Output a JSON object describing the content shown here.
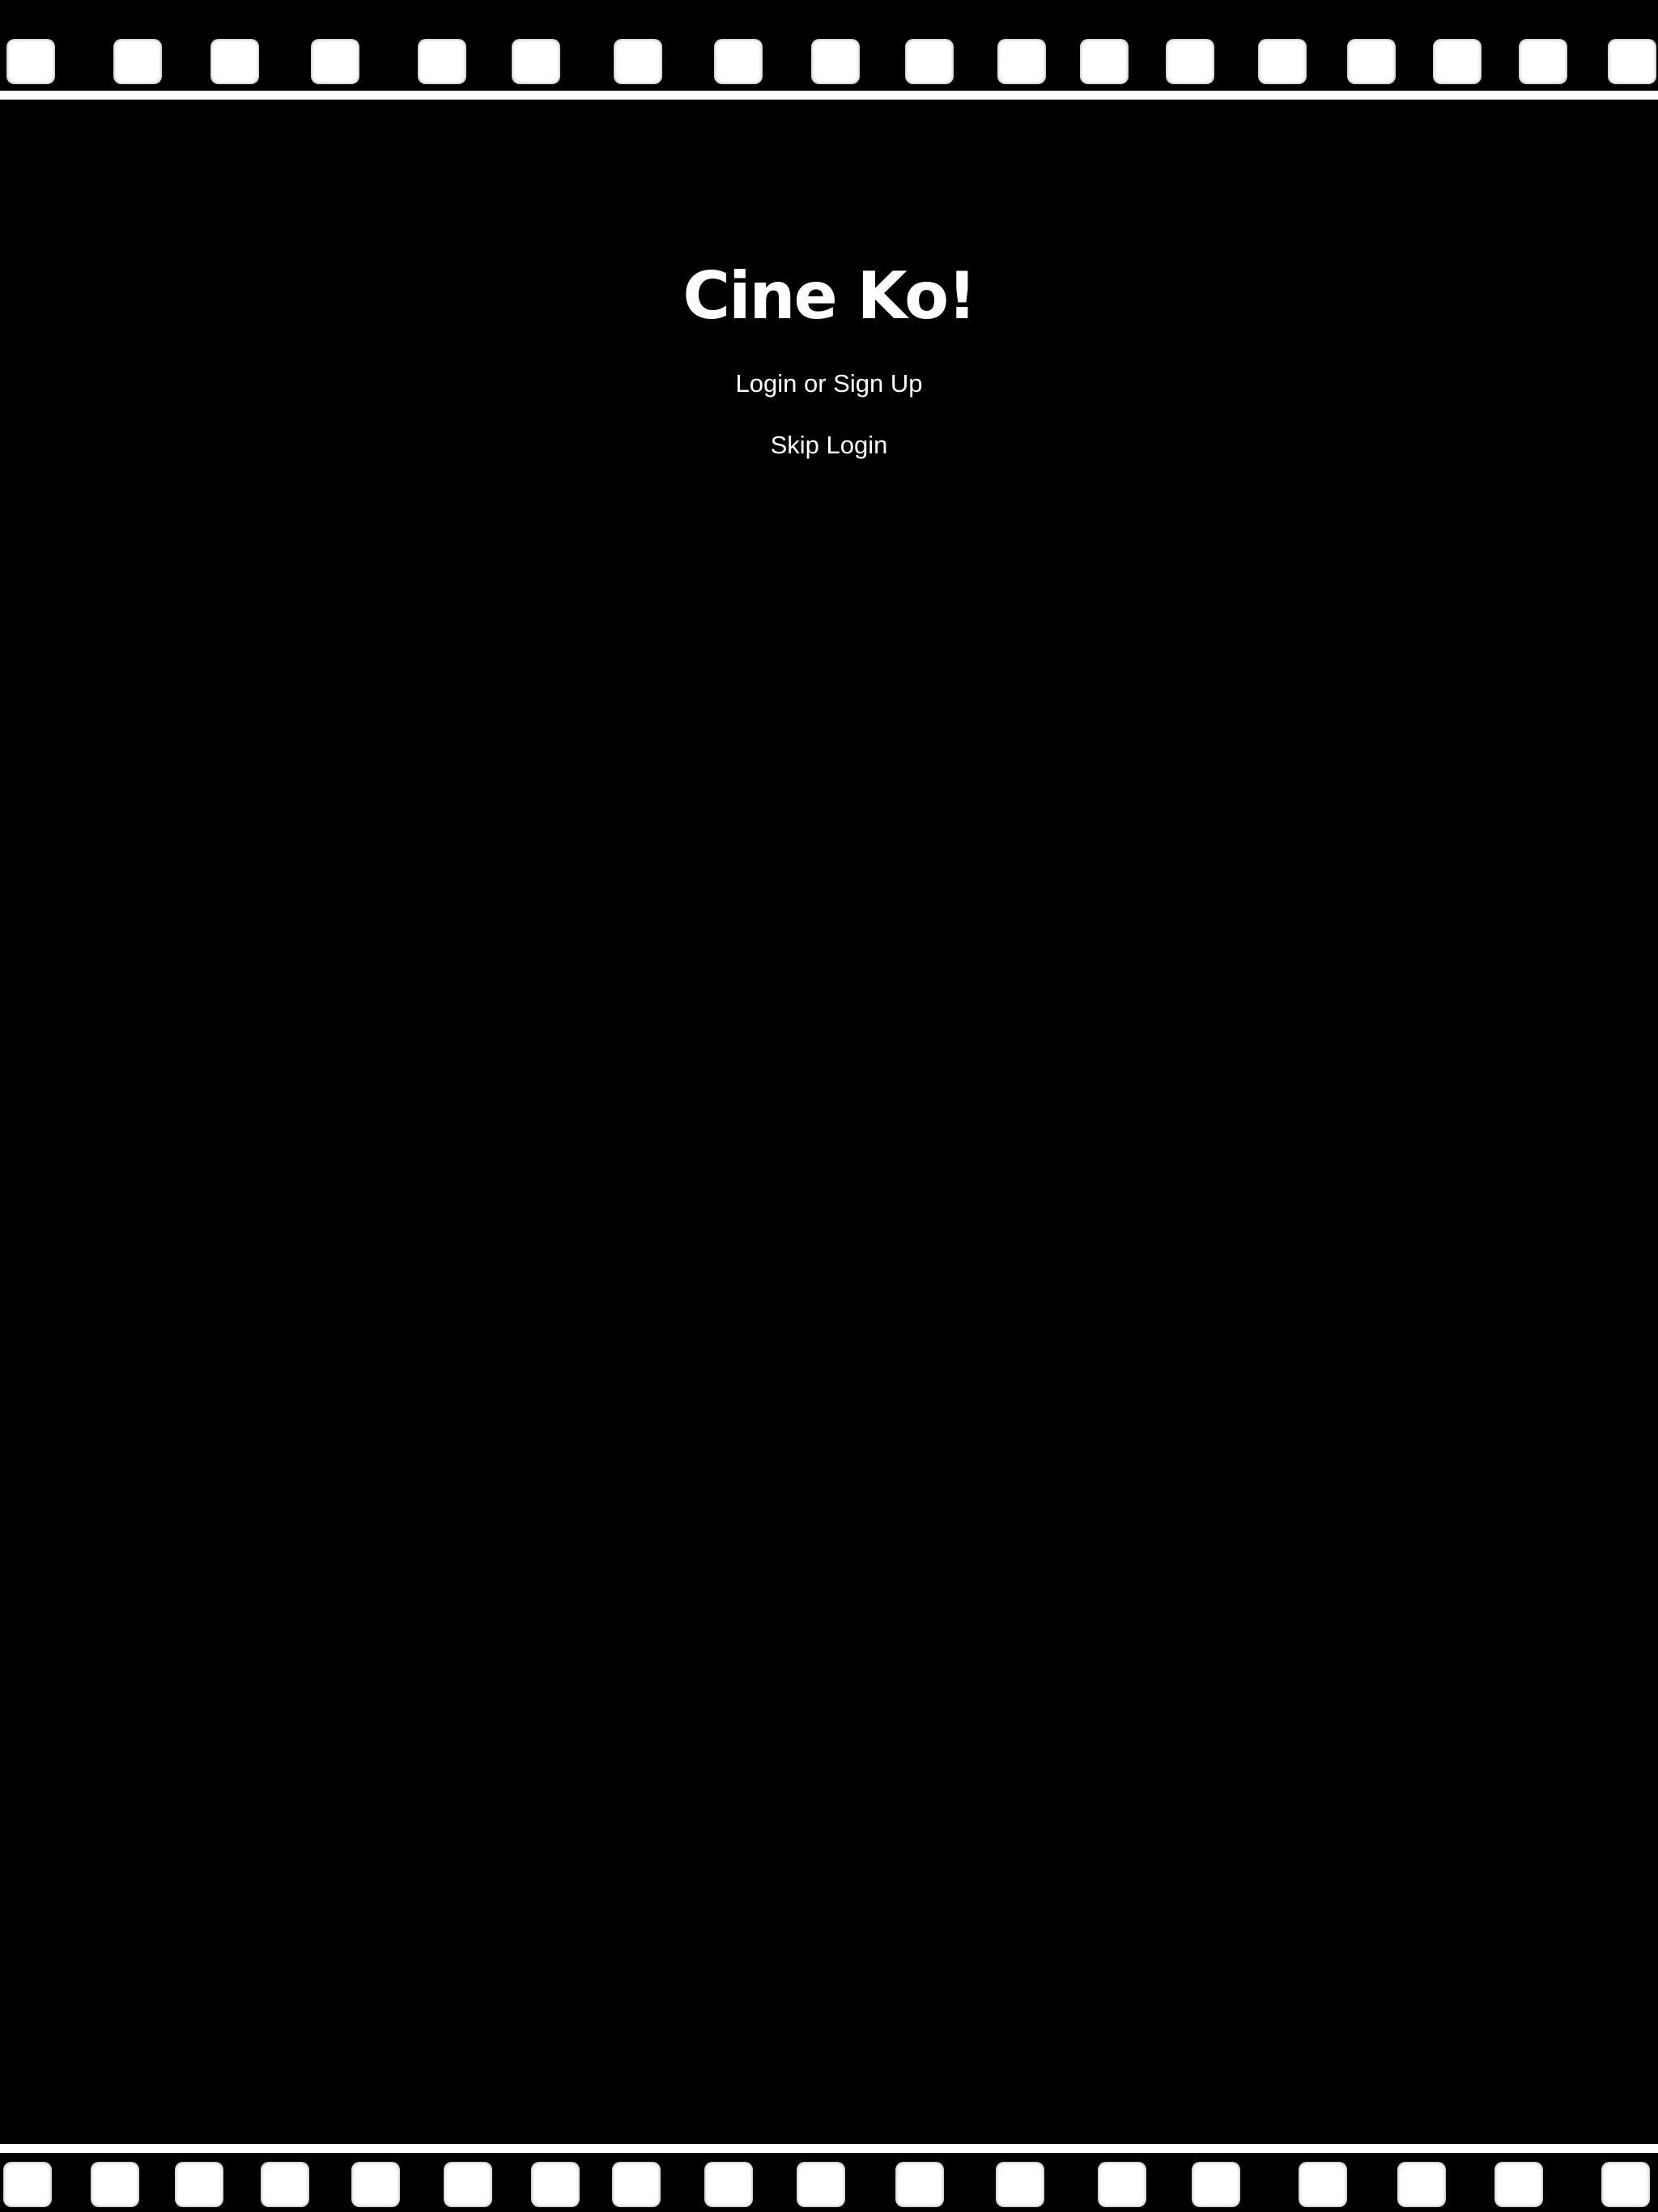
{
  "app": {
    "title": "Cine Ko!"
  },
  "actions": {
    "login_signup": "Login or Sign Up",
    "skip_login": "Skip Login"
  },
  "theme": {
    "background": "#000000",
    "foreground": "#ffffff"
  },
  "decoration": {
    "top_border": "film-strip",
    "bottom_border": "film-strip"
  }
}
